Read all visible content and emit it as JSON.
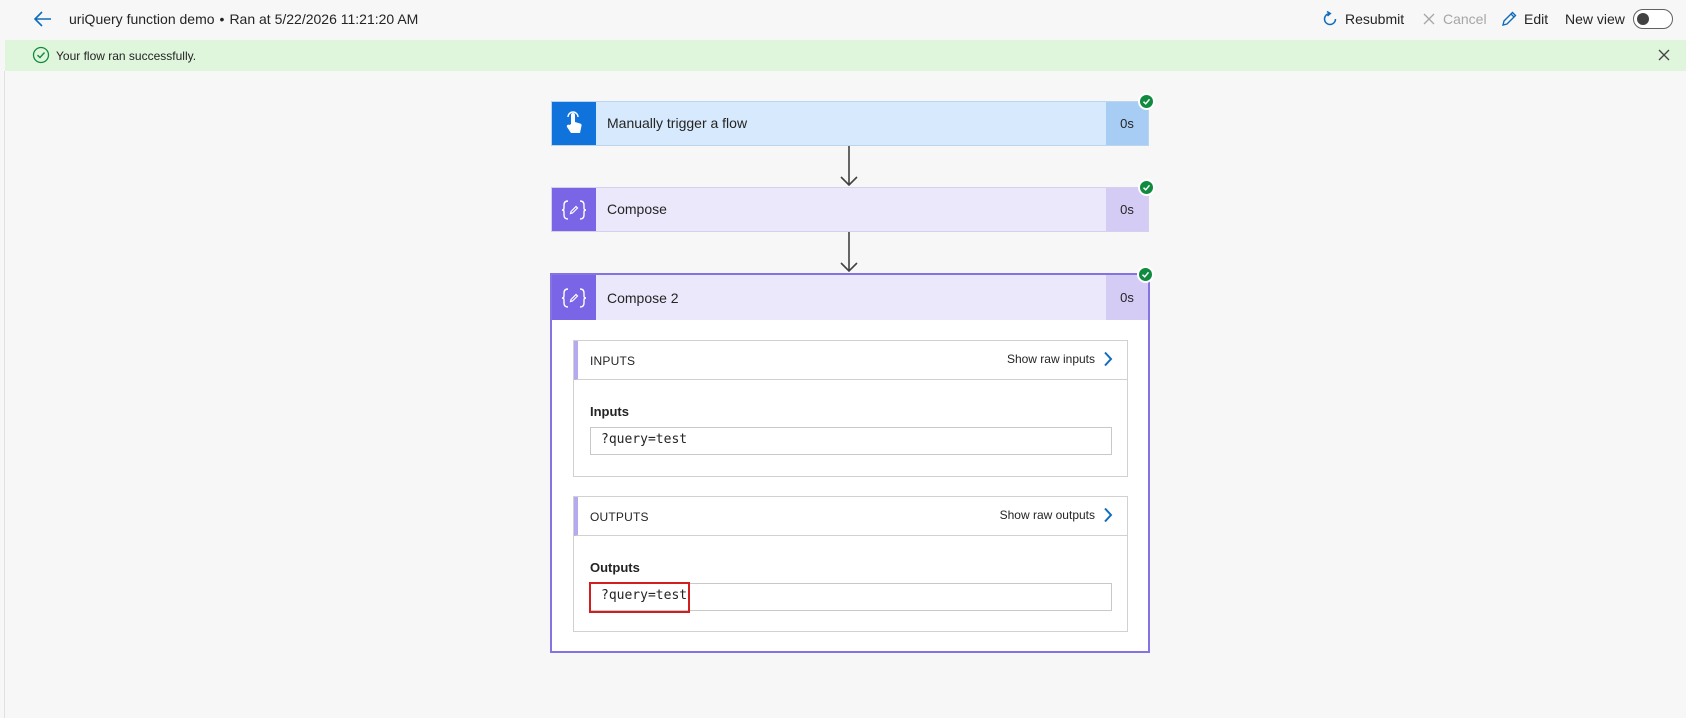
{
  "header": {
    "flow_name": "uriQuery function demo",
    "separator": "•",
    "run_info": "Ran at 5/22/2026 11:21:20 AM",
    "resubmit_label": "Resubmit",
    "cancel_label": "Cancel",
    "edit_label": "Edit",
    "new_view_label": "New view",
    "new_view_on": false
  },
  "banner": {
    "message": "Your flow ran successfully.",
    "color": "#dff6dd"
  },
  "steps": [
    {
      "label": "Manually trigger a flow",
      "duration": "0s",
      "status": "succeeded",
      "icon": "touch-trigger-icon",
      "color": "#0f73db"
    },
    {
      "label": "Compose",
      "duration": "0s",
      "status": "succeeded",
      "icon": "compose-icon",
      "color": "#7a65e6"
    },
    {
      "label": "Compose 2",
      "duration": "0s",
      "status": "succeeded",
      "icon": "compose-icon",
      "color": "#7a65e6"
    }
  ],
  "details": {
    "inputs": {
      "section_title": "INPUTS",
      "raw_link": "Show raw inputs",
      "field_label": "Inputs",
      "field_value": "?query=test"
    },
    "outputs": {
      "section_title": "OUTPUTS",
      "raw_link": "Show raw outputs",
      "field_label": "Outputs",
      "field_value": "?query=test"
    }
  },
  "colors": {
    "accent": "#0f6cbd",
    "success": "#108a3e",
    "highlight": "#d11f1f"
  }
}
